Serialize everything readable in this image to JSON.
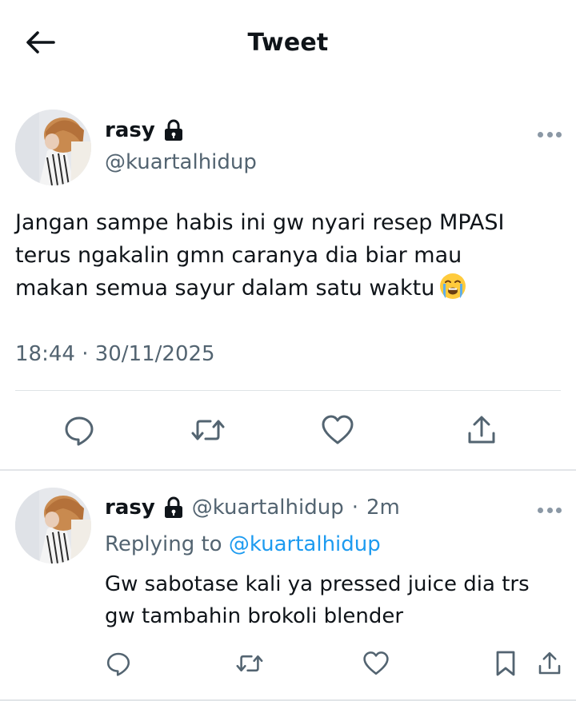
{
  "header": {
    "title": "Tweet",
    "back_icon": "arrow-left-icon"
  },
  "tweet": {
    "author": {
      "display_name": "rasy",
      "handle": "@kuartalhidup",
      "protected": true
    },
    "text": "Jangan sampe habis ini gw nyari resep MPASI\nterus ngakalin gmn caranya dia biar mau\nmakan semua sayur dalam satu waktu",
    "emoji": "loudly-crying-face",
    "timestamp": "18:44 · 30/11/2025",
    "actions": [
      "reply-icon",
      "retweet-icon",
      "like-icon",
      "share-icon"
    ]
  },
  "reply": {
    "author": {
      "display_name": "rasy",
      "handle": "@kuartalhidup",
      "protected": true
    },
    "separator": "·",
    "time": "2m",
    "replying_prefix": "Replying to",
    "replying_to": "@kuartalhidup",
    "text": "Gw sabotase kali ya pressed juice dia trs\ngw tambahin brokoli blender",
    "actions": [
      "reply-icon",
      "retweet-icon",
      "like-icon",
      "bookmark-icon",
      "share-icon"
    ]
  },
  "colors": {
    "text": "#0f1419",
    "secondary": "#536471",
    "link": "#1d9bf0",
    "divider": "#e2e5e8"
  }
}
